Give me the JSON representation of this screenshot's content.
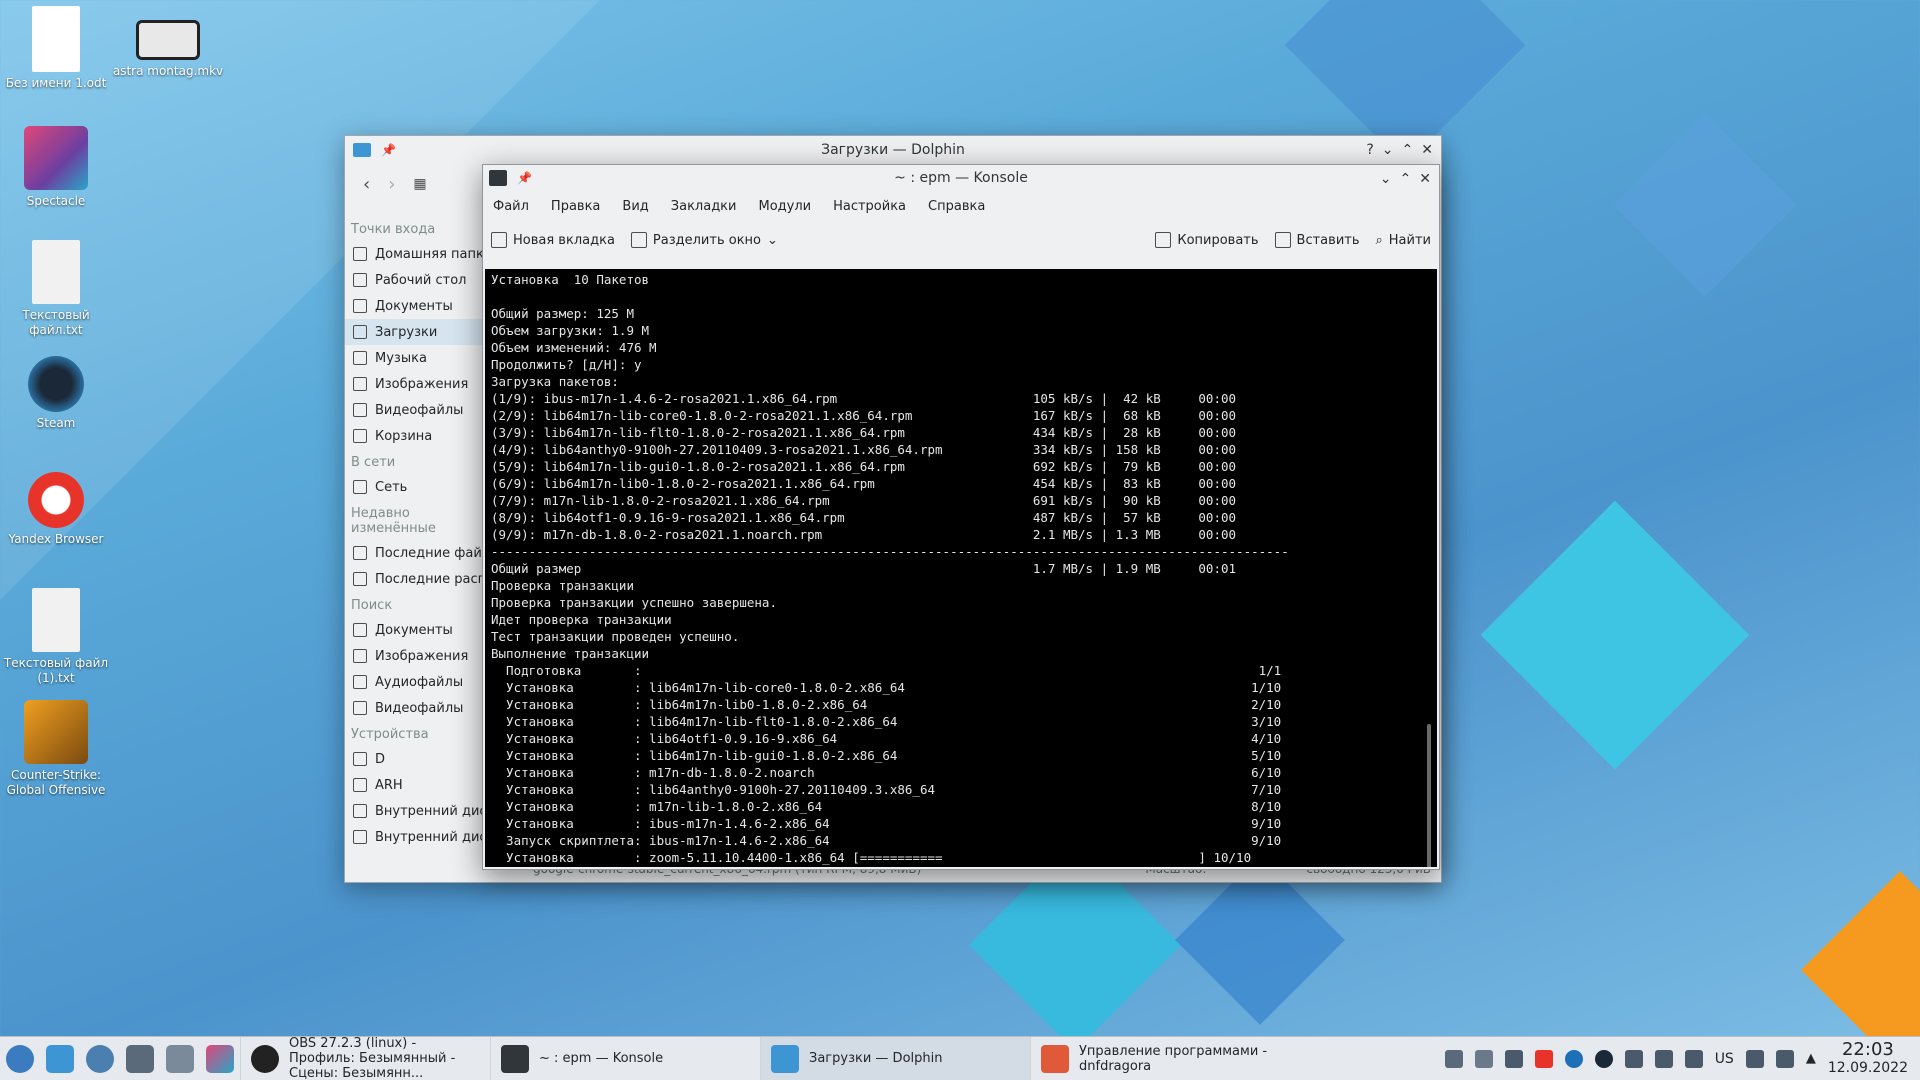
{
  "desktop": {
    "icons": [
      {
        "label": "Без имени 1.odt"
      },
      {
        "label": "astra montag.mkv"
      },
      {
        "label": "Spectacle"
      },
      {
        "label": "Текстовый файл.txt"
      },
      {
        "label": "Steam"
      },
      {
        "label": "Yandex Browser"
      },
      {
        "label": "Текстовый файл (1).txt"
      },
      {
        "label": "Counter-Strike: Global Offensive"
      }
    ]
  },
  "dolphin": {
    "title": "Загрузки — Dolphin",
    "sections": {
      "entry_points": "Точки входа",
      "network": "В сети",
      "recent": "Недавно изменённые",
      "search": "Поиск",
      "devices": "Устройства"
    },
    "entry_items": [
      "Домашняя папка",
      "Рабочий стол",
      "Документы",
      "Загрузки",
      "Музыка",
      "Изображения",
      "Видеофайлы",
      "Корзина"
    ],
    "network_items": [
      "Сеть"
    ],
    "recent_items": [
      "Последние файлы",
      "Последние расположения"
    ],
    "search_items": [
      "Документы",
      "Изображения",
      "Аудиофайлы",
      "Видеофайлы"
    ],
    "device_items": [
      "D",
      "ARH",
      "Внутренний диск",
      "Внутренний диск"
    ],
    "status_file": "google-chrome-stable_current_x86_64.rpm (тип RPM, 89,8 МиБ)",
    "status_zoom": "Масштаб:",
    "status_free": "свободно 123,0 ГиБ"
  },
  "konsole": {
    "title": "~ : epm — Konsole",
    "menu": [
      "Файл",
      "Правка",
      "Вид",
      "Закладки",
      "Модули",
      "Настройка",
      "Справка"
    ],
    "toolbar": {
      "new_tab": "Новая вкладка",
      "split": "Разделить окно",
      "copy": "Копировать",
      "paste": "Вставить",
      "find": "Найти"
    },
    "lines": [
      "Установка  10 Пакетов",
      "",
      "Общий размер: 125 M",
      "Объем загрузки: 1.9 M",
      "Объем изменений: 476 M",
      "Продолжить? [д/Н]: y",
      "Загрузка пакетов:",
      "(1/9): ibus-m17n-1.4.6-2-rosa2021.1.x86_64.rpm                          105 kB/s |  42 kB     00:00",
      "(2/9): lib64m17n-lib-core0-1.8.0-2-rosa2021.1.x86_64.rpm                167 kB/s |  68 kB     00:00",
      "(3/9): lib64m17n-lib-flt0-1.8.0-2-rosa2021.1.x86_64.rpm                 434 kB/s |  28 kB     00:00",
      "(4/9): lib64anthy0-9100h-27.20110409.3-rosa2021.1.x86_64.rpm            334 kB/s | 158 kB     00:00",
      "(5/9): lib64m17n-lib-gui0-1.8.0-2-rosa2021.1.x86_64.rpm                 692 kB/s |  79 kB     00:00",
      "(6/9): lib64m17n-lib0-1.8.0-2-rosa2021.1.x86_64.rpm                     454 kB/s |  83 kB     00:00",
      "(7/9): m17n-lib-1.8.0-2-rosa2021.1.x86_64.rpm                           691 kB/s |  90 kB     00:00",
      "(8/9): lib64otf1-0.9.16-9-rosa2021.1.x86_64.rpm                         487 kB/s |  57 kB     00:00",
      "(9/9): m17n-db-1.8.0-2-rosa2021.1.noarch.rpm                            2.1 MB/s | 1.3 MB     00:00",
      "----------------------------------------------------------------------------------------------------------",
      "Общий размер                                                            1.7 MB/s | 1.9 MB     00:01",
      "Проверка транзакции",
      "Проверка транзакции успешно завершена.",
      "Идет проверка транзакции",
      "Тест транзакции проведен успешно.",
      "Выполнение транзакции",
      "  Подготовка       :                                                                                  1/1",
      "  Установка        : lib64m17n-lib-core0-1.8.0-2.x86_64                                              1/10",
      "  Установка        : lib64m17n-lib0-1.8.0-2.x86_64                                                   2/10",
      "  Установка        : lib64m17n-lib-flt0-1.8.0-2.x86_64                                               3/10",
      "  Установка        : lib64otf1-0.9.16-9.x86_64                                                       4/10",
      "  Установка        : lib64m17n-lib-gui0-1.8.0-2.x86_64                                               5/10",
      "  Установка        : m17n-db-1.8.0-2.noarch                                                          6/10",
      "  Установка        : lib64anthy0-9100h-27.20110409.3.x86_64                                          7/10",
      "  Установка        : m17n-lib-1.8.0-2.x86_64                                                         8/10",
      "  Установка        : ibus-m17n-1.4.6-2.x86_64                                                        9/10",
      "  Запуск скриптлета: ibus-m17n-1.4.6-2.x86_64                                                        9/10",
      "  Установка        : zoom-5.11.10.4400-1.x86_64 [===========                                  ] 10/10"
    ]
  },
  "taskbar": {
    "tasks": [
      {
        "label": "OBS 27.2.3 (linux) - Профиль: Безымянный - Сцены: Безымянн..."
      },
      {
        "label": "~ : epm — Konsole"
      },
      {
        "label": "Загрузки — Dolphin"
      },
      {
        "label": "Управление программами - dnfdragora"
      }
    ],
    "keyboard_layout": "US",
    "time": "22:03",
    "date": "12.09.2022"
  }
}
